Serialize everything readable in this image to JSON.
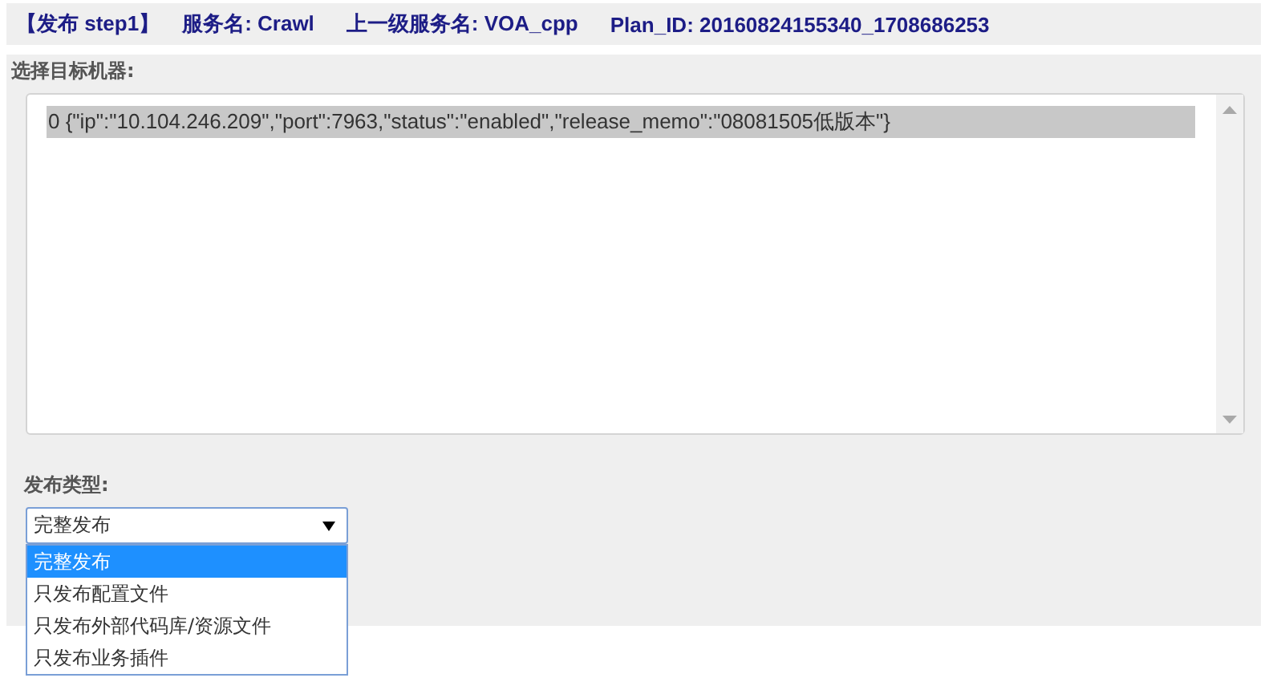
{
  "header": [
    "【发布 step1】",
    "服务名: Crawl",
    "上一级服务名: VOA_cpp",
    "Plan_ID: 20160824155340_1708686253"
  ],
  "target_machines": {
    "label": "选择目标机器:",
    "options": [
      {
        "text": "0 {\"ip\":\"10.104.246.209\",\"port\":7963,\"status\":\"enabled\",\"release_memo\":\"08081505低版本\"}",
        "selected": true
      }
    ]
  },
  "release_type": {
    "label": "发布类型:",
    "value": "完整发布",
    "expanded": true,
    "options": [
      {
        "text": "完整发布",
        "selected": true
      },
      {
        "text": "只发布配置文件",
        "selected": false
      },
      {
        "text": "只发布外部代码库/资源文件",
        "selected": false
      },
      {
        "text": "只发布业务插件",
        "selected": false
      }
    ]
  }
}
